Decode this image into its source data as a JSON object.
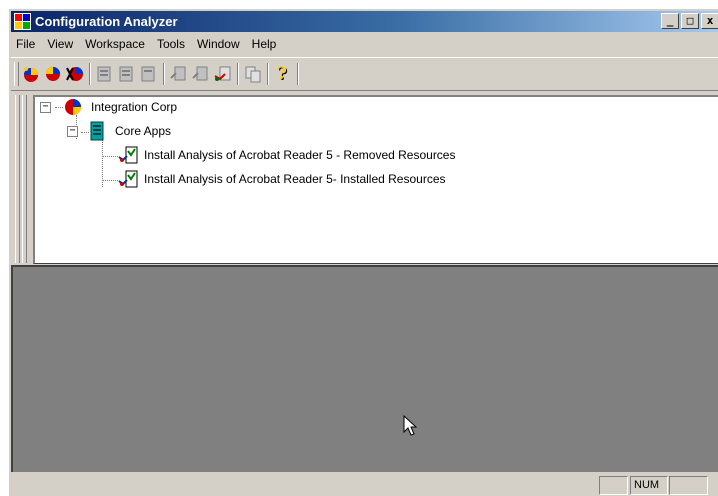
{
  "window": {
    "title": "Configuration Analyzer",
    "controls": {
      "minimize": "_",
      "maximize": "□",
      "close": "x"
    }
  },
  "menu": [
    "File",
    "View",
    "Workspace",
    "Tools",
    "Window",
    "Help"
  ],
  "toolbar": {
    "buttons": [
      "new-workspace-icon",
      "open-workspace-icon",
      "delete-workspace-icon",
      "new-folder-icon",
      "open-folder-icon",
      "close-folder-icon",
      "new-analysis-icon",
      "open-analysis-icon",
      "run-analysis-icon",
      "copy-icon",
      "help-icon"
    ]
  },
  "tree": {
    "root": {
      "label": "Integration Corp",
      "expander": "−"
    },
    "folder": {
      "label": "Core Apps",
      "expander": "−"
    },
    "items": [
      {
        "label": "Install Analysis of Acrobat Reader 5 - Removed Resources"
      },
      {
        "label": "Install Analysis of Acrobat Reader 5- Installed Resources"
      }
    ]
  },
  "statusbar": {
    "main": "",
    "num": "NUM",
    "extra": ""
  },
  "colors": {
    "title_start": "#0a246a",
    "title_end": "#a6caf0",
    "face": "#d4d0c8",
    "workspace": "#808080"
  }
}
